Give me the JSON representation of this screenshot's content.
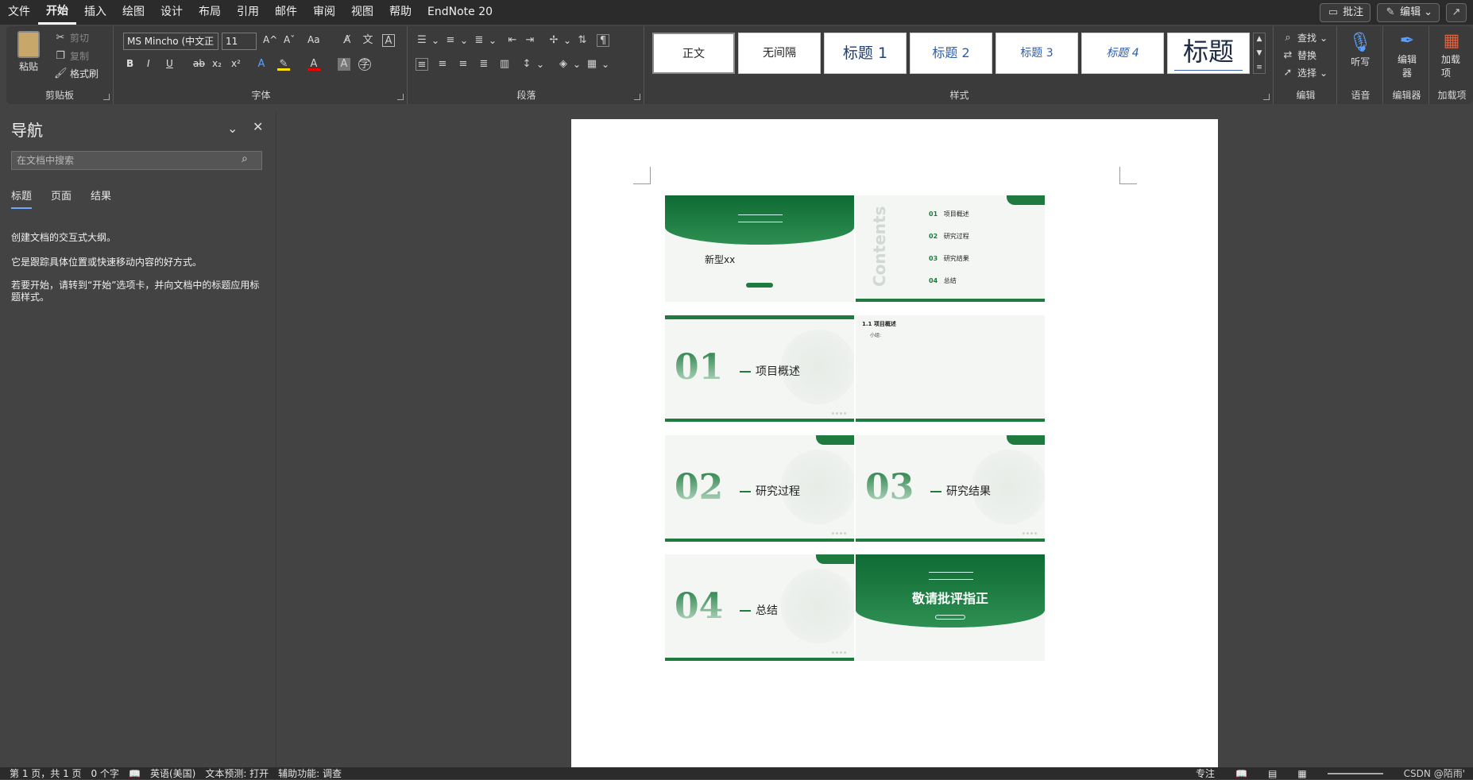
{
  "menubar": {
    "items": [
      "文件",
      "开始",
      "插入",
      "绘图",
      "设计",
      "布局",
      "引用",
      "邮件",
      "审阅",
      "视图",
      "帮助",
      "EndNote 20"
    ],
    "active": "开始",
    "comment_btn": "批注",
    "edit_btn": "编辑"
  },
  "ribbon": {
    "clipboard": {
      "paste": "粘贴",
      "cut": "剪切",
      "copy": "复制",
      "format_painter": "格式刷",
      "label": "剪贴板"
    },
    "font": {
      "name": "MS Mincho (中文正",
      "size": "11",
      "label": "字体",
      "bold": "B",
      "italic": "I",
      "underline": "U",
      "strike": "ab",
      "sub": "x₂",
      "sup": "x²",
      "grow": "A^",
      "shrink": "Aˇ",
      "case": "Aa"
    },
    "paragraph": {
      "label": "段落"
    },
    "styles": {
      "items": [
        "正文",
        "无间隔",
        "标题 1",
        "标题 2",
        "标题 3",
        "标题 4",
        "标题"
      ],
      "label": "样式"
    },
    "editing": {
      "find": "查找",
      "replace": "替换",
      "select": "选择",
      "label": "编辑"
    },
    "voice": {
      "dictate": "听写",
      "label": "语音"
    },
    "editor": {
      "btn": "编辑器",
      "label": "编辑器"
    },
    "addins": {
      "btn": "加载项",
      "label": "加载项"
    }
  },
  "nav": {
    "title": "导航",
    "search_placeholder": "在文档中搜索",
    "tabs": [
      "标题",
      "页面",
      "结果"
    ],
    "active_tab": "标题",
    "line1": "创建文档的交互式大纲。",
    "line2": "它是跟踪具体位置或快速移动内容的好方式。",
    "line3": "若要开始，请转到“开始”选项卡，并向文档中的标题应用标题样式。"
  },
  "slides": {
    "s1_title": "新型xx",
    "contents_word": "Contents",
    "toc": [
      {
        "num": "01",
        "label": "项目概述"
      },
      {
        "num": "02",
        "label": "研究过程"
      },
      {
        "num": "03",
        "label": "研究结果"
      },
      {
        "num": "04",
        "label": "总结"
      }
    ],
    "s3_num": "01",
    "s3_title": "项目概述",
    "s4_head": "1.1 项目概述",
    "s4_sub": "小组:",
    "s5_num": "02",
    "s5_title": "研究过程",
    "s6_num": "03",
    "s6_title": "研究结果",
    "s7_num": "04",
    "s7_title": "总结",
    "s8_title": "敬请批评指正"
  },
  "status": {
    "page": "第 1 页，共 1 页",
    "words": "0 个字",
    "lang": "英语(美国)",
    "predict": "文本预测: 打开",
    "access": "辅助功能: 调查",
    "focus": "专注",
    "watermark": "CSDN @陌雨'"
  },
  "colors": {
    "slide_green": "#1f7a3f",
    "accent_blue": "#6fa8ff"
  }
}
